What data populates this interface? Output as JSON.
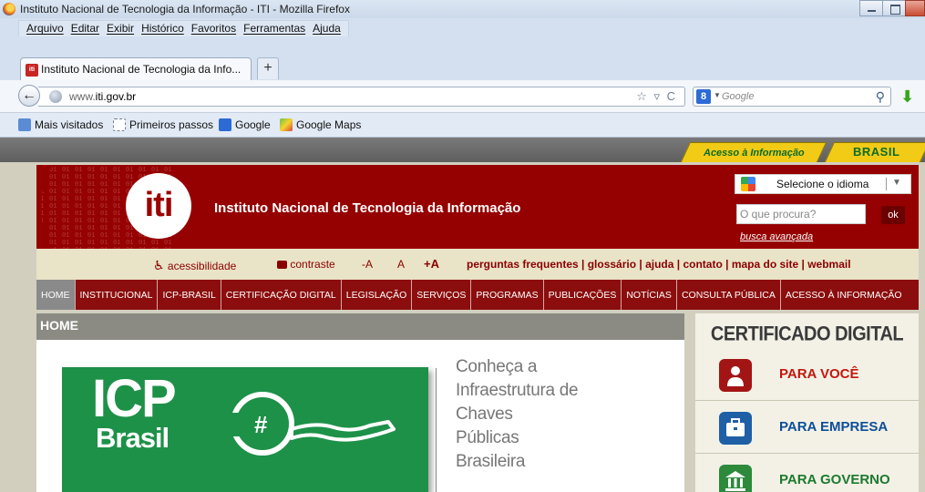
{
  "window": {
    "title": "Instituto Nacional de Tecnologia da Informação - ITI - Mozilla Firefox"
  },
  "menubar": {
    "items": [
      "Arquivo",
      "Editar",
      "Exibir",
      "Histórico",
      "Favoritos",
      "Ferramentas",
      "Ajuda"
    ]
  },
  "tabs": [
    {
      "label": "Instituto Nacional de Tecnologia da Info...",
      "favicon": "iti-favicon",
      "close": "×"
    }
  ],
  "newtab_label": "+",
  "navbar": {
    "back": "←",
    "url_prefix": "www.",
    "url_domain": "iti.gov.br",
    "url_controls": "☆ ▿ C",
    "search_engine_glyph": "8",
    "search_placeholder": "Google",
    "search_icon": "⚲",
    "download_icon": "⬇"
  },
  "bookmarks": [
    "Mais visitados",
    "Primeiros passos",
    "Google",
    "Google Maps"
  ],
  "gov_bar": {
    "acesso": "Acesso à Informação",
    "brasil": "BRASIL"
  },
  "header": {
    "logo_text": "iti",
    "title": "Instituto Nacional de Tecnologia da Informação",
    "language_select": "Selecione o idioma",
    "language_arrow": "▼",
    "search_placeholder": "O que procura?",
    "ok": "ok",
    "advanced_search": "busca avançada"
  },
  "utility": {
    "acessibilidade": "acessibilidade",
    "contraste": "contraste",
    "font_minus": "-A",
    "font_normal": "A",
    "font_plus": "+A",
    "links": "perguntas frequentes  |  glossário  |  ajuda  |  contato  |  mapa do site  |  webmail"
  },
  "mainnav": [
    "HOME",
    "INSTITUCIONAL",
    "ICP-BRASIL",
    "CERTIFICAÇÃO DIGITAL",
    "LEGISLAÇÃO",
    "SERVIÇOS",
    "PROGRAMAS",
    "PUBLICAÇÕES",
    "NOTÍCIAS",
    "CONSULTA PÚBLICA",
    "ACESSO À INFORMAÇÃO"
  ],
  "content": {
    "heading": "HOME",
    "icp_line1": "ICP",
    "icp_line2": "Brasil",
    "conheca_lines": [
      "Conheça a",
      "Infraestrutura de",
      "Chaves",
      "Públicas",
      "Brasileira"
    ]
  },
  "sidebar": {
    "title": "CERTIFICADO DIGITAL",
    "items": [
      {
        "label": "PARA VOCÊ",
        "color": "#c2180e",
        "icon_bg": "#a31515"
      },
      {
        "label": "PARA EMPRESA",
        "color": "#0d4f99",
        "icon_bg": "#1e5fa6"
      },
      {
        "label": "PARA GOVERNO",
        "color": "#1c7a2e",
        "icon_bg": "#2c8a3a"
      }
    ]
  }
}
